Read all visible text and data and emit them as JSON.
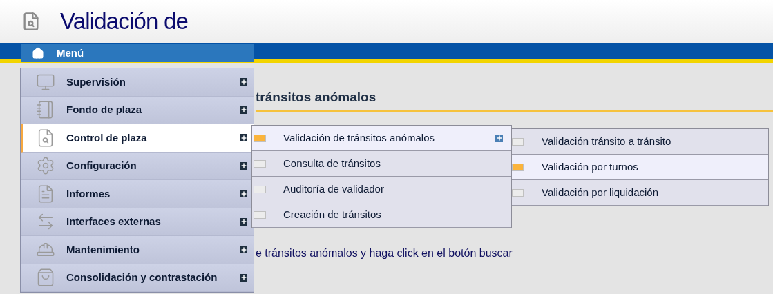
{
  "header": {
    "title": "Validación de"
  },
  "menu_bar": {
    "label": "Menú"
  },
  "page": {
    "heading": "tránsitos anómalos",
    "instruction": "e tránsitos anómalos y haga click en el botón buscar"
  },
  "menu": [
    {
      "label": "Supervisión",
      "selected": false,
      "has_children": true
    },
    {
      "label": "Fondo de plaza",
      "selected": false,
      "has_children": true
    },
    {
      "label": "Control de plaza",
      "selected": true,
      "has_children": true
    },
    {
      "label": "Configuración",
      "selected": false,
      "has_children": true
    },
    {
      "label": "Informes",
      "selected": false,
      "has_children": true
    },
    {
      "label": "Interfaces externas",
      "selected": false,
      "has_children": true
    },
    {
      "label": "Mantenimiento",
      "selected": false,
      "has_children": true
    },
    {
      "label": "Consolidación y contrastación",
      "selected": false,
      "has_children": true
    }
  ],
  "submenu": [
    {
      "label": "Validación de tránsitos anómalos",
      "selected": true,
      "has_children": true
    },
    {
      "label": "Consulta de tránsitos",
      "selected": false,
      "has_children": false
    },
    {
      "label": "Auditoría de validador",
      "selected": false,
      "has_children": false
    },
    {
      "label": "Creación de tránsitos",
      "selected": false,
      "has_children": false
    }
  ],
  "submenu_2": [
    {
      "label": "Validación tránsito a tránsito",
      "selected": false
    },
    {
      "label": "Validación por turnos",
      "selected": true
    },
    {
      "label": "Validación por liquidación",
      "selected": false
    }
  ]
}
